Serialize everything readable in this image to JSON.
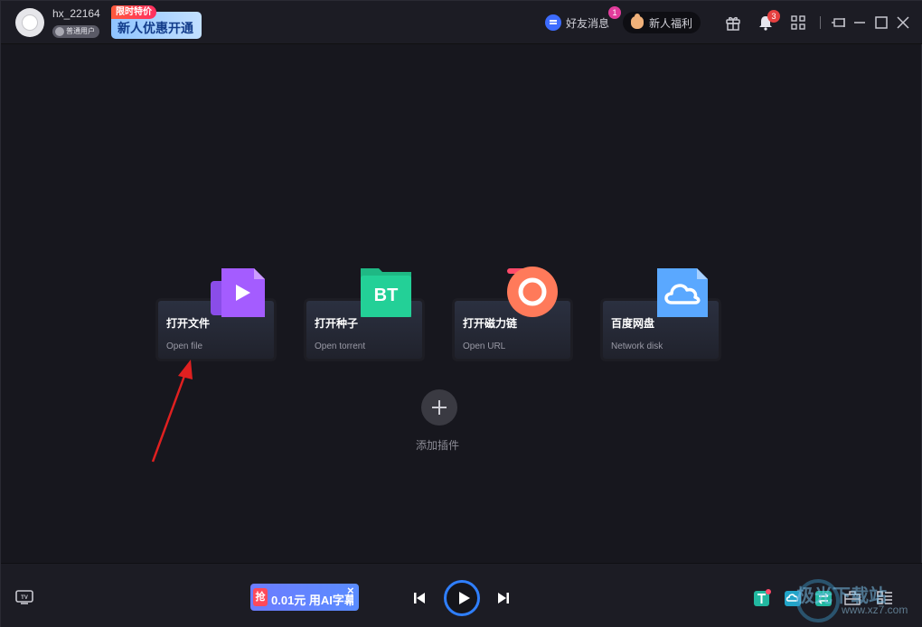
{
  "user": {
    "username": "hx_22164",
    "badge": "普通用户"
  },
  "promo": {
    "tag": "限时特价",
    "text": "新人优惠开通"
  },
  "topbar": {
    "friends_label": "好友消息",
    "friends_count": "1",
    "welfare_label": "新人福利",
    "notifications_count": "3"
  },
  "cards": [
    {
      "title": "打开文件",
      "subtitle": "Open file",
      "icon": "file-play-icon"
    },
    {
      "title": "打开种子",
      "subtitle": "Open torrent",
      "icon": "bt-torrent-icon"
    },
    {
      "title": "打开磁力链",
      "subtitle": "Open URL",
      "icon": "magnet-link-icon"
    },
    {
      "title": "百度网盘",
      "subtitle": "Network disk",
      "icon": "cloud-disk-icon"
    }
  ],
  "add_plugin": {
    "label": "添加插件"
  },
  "bottombar": {
    "ai_tag": "抢",
    "ai_text": "0.01元 用AI字幕",
    "ai_close": "×"
  },
  "watermark": {
    "text": "极光下载站",
    "sub": "www.xz7.com"
  },
  "colors": {
    "accent": "#2f7fff",
    "background": "#17171e",
    "annotation_arrow": "#e02020"
  }
}
